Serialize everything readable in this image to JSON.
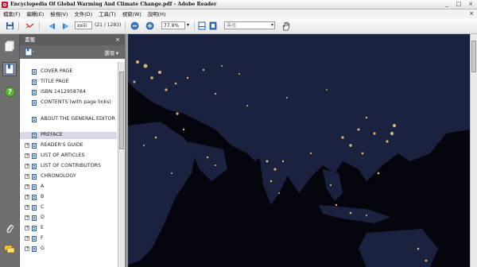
{
  "window": {
    "title": "Encyclopedia Of Global Warming And Climate Change.pdf - Adobe Reader",
    "controls": [
      "_",
      "□",
      "×"
    ]
  },
  "menu": {
    "items": [
      "檔案(F)",
      "編輯(E)",
      "檢視(V)",
      "文件(D)",
      "工具(T)",
      "視窗(W)",
      "說明(H)"
    ],
    "close": "×"
  },
  "toolbar": {
    "page_value": "xxiii",
    "page_count": "(21 / 1283)",
    "zoom_value": "77.9%",
    "search_placeholder": "尋找",
    "search_dropdown": "▾"
  },
  "bookmarks_panel": {
    "title": "書籤",
    "close": "×",
    "options": "選項 ▾",
    "items": [
      {
        "label": "COVER PAGE",
        "expandable": false
      },
      {
        "label": "TITLE PAGE",
        "expandable": false
      },
      {
        "label": "ISBN 1412958784",
        "expandable": false
      },
      {
        "label": "CONTENTS (with page links)",
        "expandable": false
      },
      {
        "label": "ABOUT THE GENERAL EDITOR",
        "expandable": false
      },
      {
        "label": "PREFACE",
        "expandable": false,
        "selected": true
      },
      {
        "label": "READER'S GUIDE",
        "expandable": true
      },
      {
        "label": "LIST OF ARTICLES",
        "expandable": true
      },
      {
        "label": "LIST OF CONTRIBUTORS",
        "expandable": true
      },
      {
        "label": "CHRONOLOGY",
        "expandable": true
      },
      {
        "label": "A",
        "expandable": true
      },
      {
        "label": "B",
        "expandable": true
      },
      {
        "label": "C",
        "expandable": true
      },
      {
        "label": "D",
        "expandable": true
      },
      {
        "label": "E",
        "expandable": true
      },
      {
        "label": "F",
        "expandable": true
      },
      {
        "label": "G",
        "expandable": true
      }
    ]
  },
  "icons": {
    "toolbar": [
      "save-icon",
      "email-icon",
      "previous-page-icon",
      "next-page-icon",
      "zoom-out-icon",
      "zoom-in-icon",
      "fit-page-icon",
      "fit-width-icon",
      "hand-tool-icon"
    ],
    "rail": [
      "pages-icon",
      "bookmarks-icon",
      "help-icon",
      "attachments-icon",
      "comments-icon"
    ]
  },
  "colors": {
    "panel_header": "#5d5d5d",
    "selected_row": "#dad7e8",
    "map_background": "#05060d",
    "city_lights": "#f3d27a"
  }
}
